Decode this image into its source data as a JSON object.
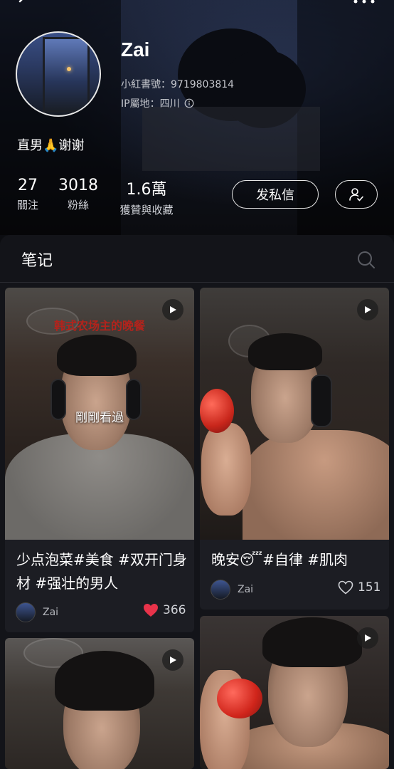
{
  "profile": {
    "username": "Zai",
    "redbook_id": "小紅書號：9719803814",
    "ip_location": "IP屬地：四川",
    "bio": "直男🙏谢谢"
  },
  "stats": {
    "following_count": "27",
    "following_label": "關注",
    "fans_count": "3018",
    "fans_label": "粉絲",
    "likes_count": "1.6萬",
    "likes_label": "獲贊與收藏"
  },
  "actions": {
    "message_label": "发私信"
  },
  "tab": {
    "label": "笔记"
  },
  "notes": [
    {
      "overlay_title": "韩式农场主的晚餐",
      "watched_label": "剛剛看過",
      "title": "少点泡菜#美食 #双开门身材 #强壮的男人",
      "author": "Zai",
      "likes": "366",
      "liked": true
    },
    {
      "title": "晚安😴#自律 #肌肉",
      "author": "Zai",
      "likes": "151",
      "liked": false
    },
    {
      "title": "",
      "author": ""
    },
    {
      "title": "",
      "author": ""
    }
  ],
  "icons": {
    "back": "back-arrow-icon",
    "more": "more-icon",
    "info": "info-icon",
    "follow": "user-check-icon",
    "search": "search-icon",
    "play": "play-icon",
    "heart": "heart-icon"
  },
  "colors": {
    "like_red": "#e8334a",
    "overlay_title_red": "#b2231c",
    "panel_bg": "#131419"
  }
}
